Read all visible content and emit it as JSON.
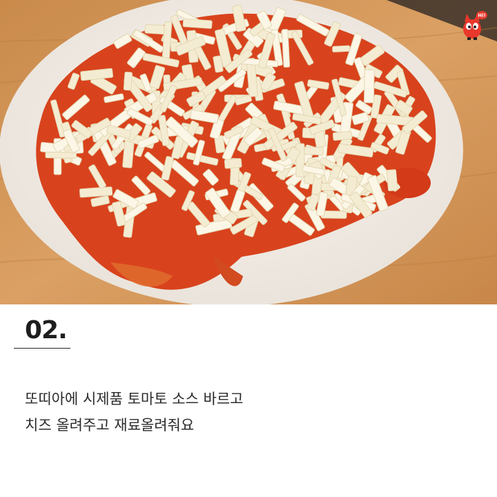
{
  "step": {
    "number": "02.",
    "description_lines": [
      "또띠아에 시제품 토마토 소스 바르고",
      "치즈 올려주고 재료올려줘요"
    ]
  },
  "mascot": {
    "icon": "red-cat-mascot-icon",
    "badge_text": "Hi!"
  },
  "colors": {
    "wood": "#d69a5a",
    "tortilla": "#f2ece4",
    "sauce": "#d8431d",
    "cheese": "#f4ecd2",
    "text": "#2a2a2a"
  }
}
